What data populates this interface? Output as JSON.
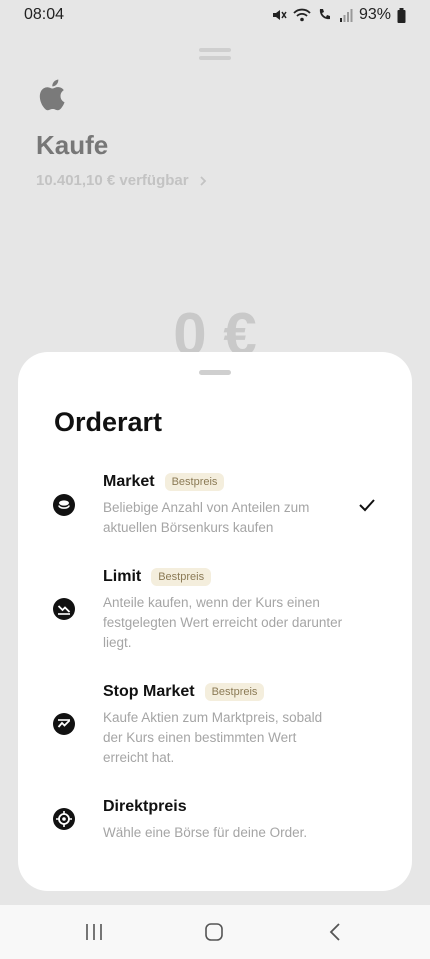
{
  "status_bar": {
    "time": "08:04",
    "battery": "93%"
  },
  "background": {
    "title": "Kaufe",
    "available": "10.401,10 € verfügbar",
    "amount": "0 €"
  },
  "sheet": {
    "title": "Orderart",
    "options": [
      {
        "name": "Market",
        "badge": "Bestpreis",
        "description": "Beliebige Anzahl von Anteilen zum aktuellen Börsenkurs kaufen",
        "selected": true,
        "icon": "coin-icon"
      },
      {
        "name": "Limit",
        "badge": "Bestpreis",
        "description": "Anteile kaufen, wenn der Kurs einen festgelegten Wert erreicht oder darunter liegt.",
        "selected": false,
        "icon": "trend-down-icon"
      },
      {
        "name": "Stop Market",
        "badge": "Bestpreis",
        "description": "Kaufe Aktien zum Marktpreis, sobald der Kurs einen bestimmten Wert erreicht hat.",
        "selected": false,
        "icon": "trend-up-icon"
      },
      {
        "name": "Direktpreis",
        "badge": "",
        "description": "Wähle eine Börse für deine Order.",
        "selected": false,
        "icon": "target-icon"
      }
    ]
  },
  "colors": {
    "accent": "#111111",
    "badge_bg": "#f4eedd",
    "badge_text": "#8b7a55",
    "muted_text": "#a5a5a5"
  }
}
